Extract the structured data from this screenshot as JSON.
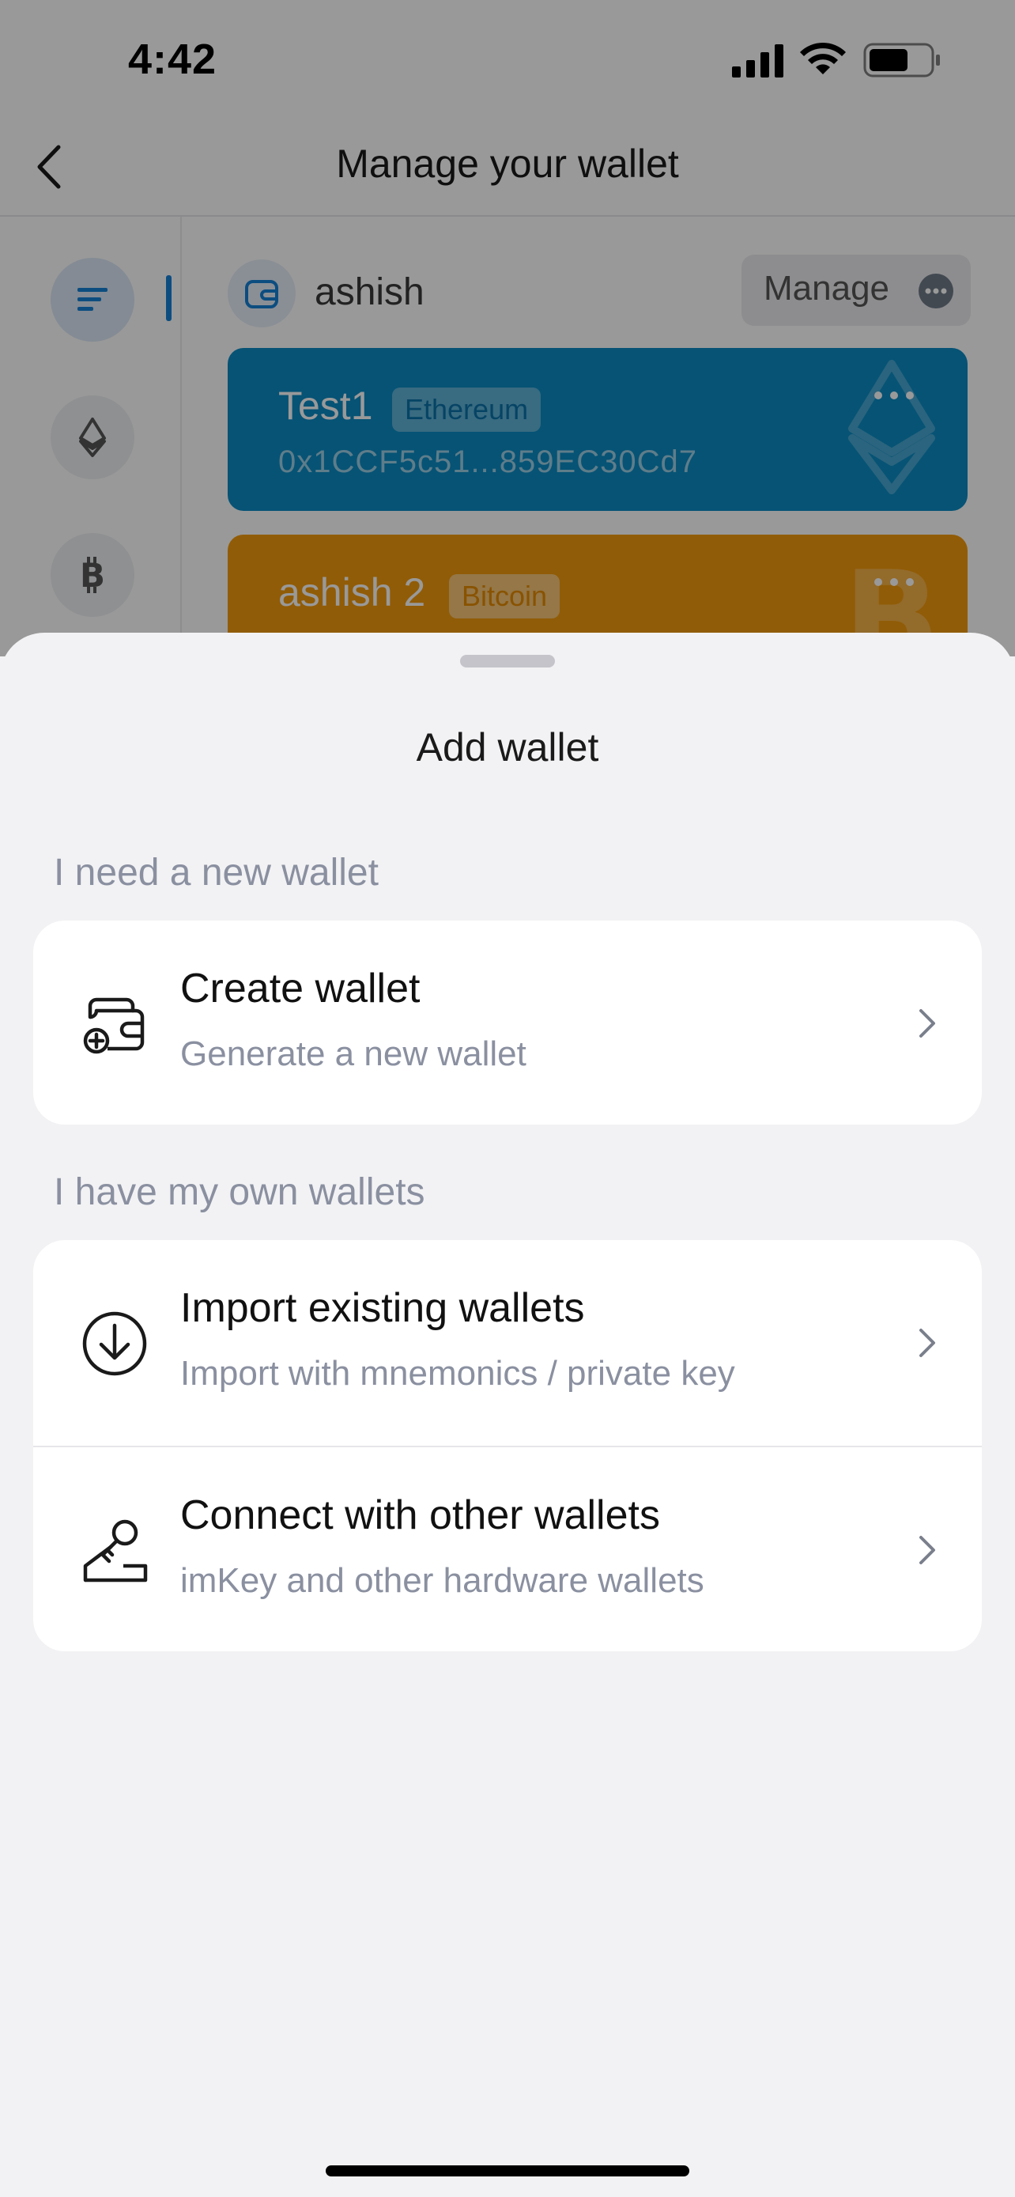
{
  "status": {
    "time": "4:42"
  },
  "nav": {
    "title": "Manage your wallet"
  },
  "sidebar": {
    "icons": [
      "list-icon",
      "ethereum-icon",
      "bitcoin-icon"
    ]
  },
  "group": {
    "name": "ashish",
    "manage_label": "Manage"
  },
  "wallets": [
    {
      "name": "Test1",
      "chain": "Ethereum",
      "address": "0x1CCF5c51...859EC30Cd7",
      "color": "#0b8ac3"
    },
    {
      "name": "ashish 2",
      "chain": "Bitcoin",
      "color": "#f29a0c"
    }
  ],
  "sheet": {
    "title": "Add wallet",
    "section_new": "I need a new wallet",
    "section_own": "I have my own wallets",
    "create": {
      "title": "Create wallet",
      "subtitle": "Generate a new wallet",
      "icon": "wallet-plus-icon"
    },
    "import": {
      "title": "Import existing wallets",
      "subtitle": "Import with mnemonics / private key",
      "icon": "download-circle-icon"
    },
    "connect": {
      "title": "Connect with other wallets",
      "subtitle": "imKey and other hardware wallets",
      "icon": "hardware-key-icon"
    }
  },
  "colors": {
    "accent": "#1480d6",
    "background": "#f2f2f4"
  }
}
